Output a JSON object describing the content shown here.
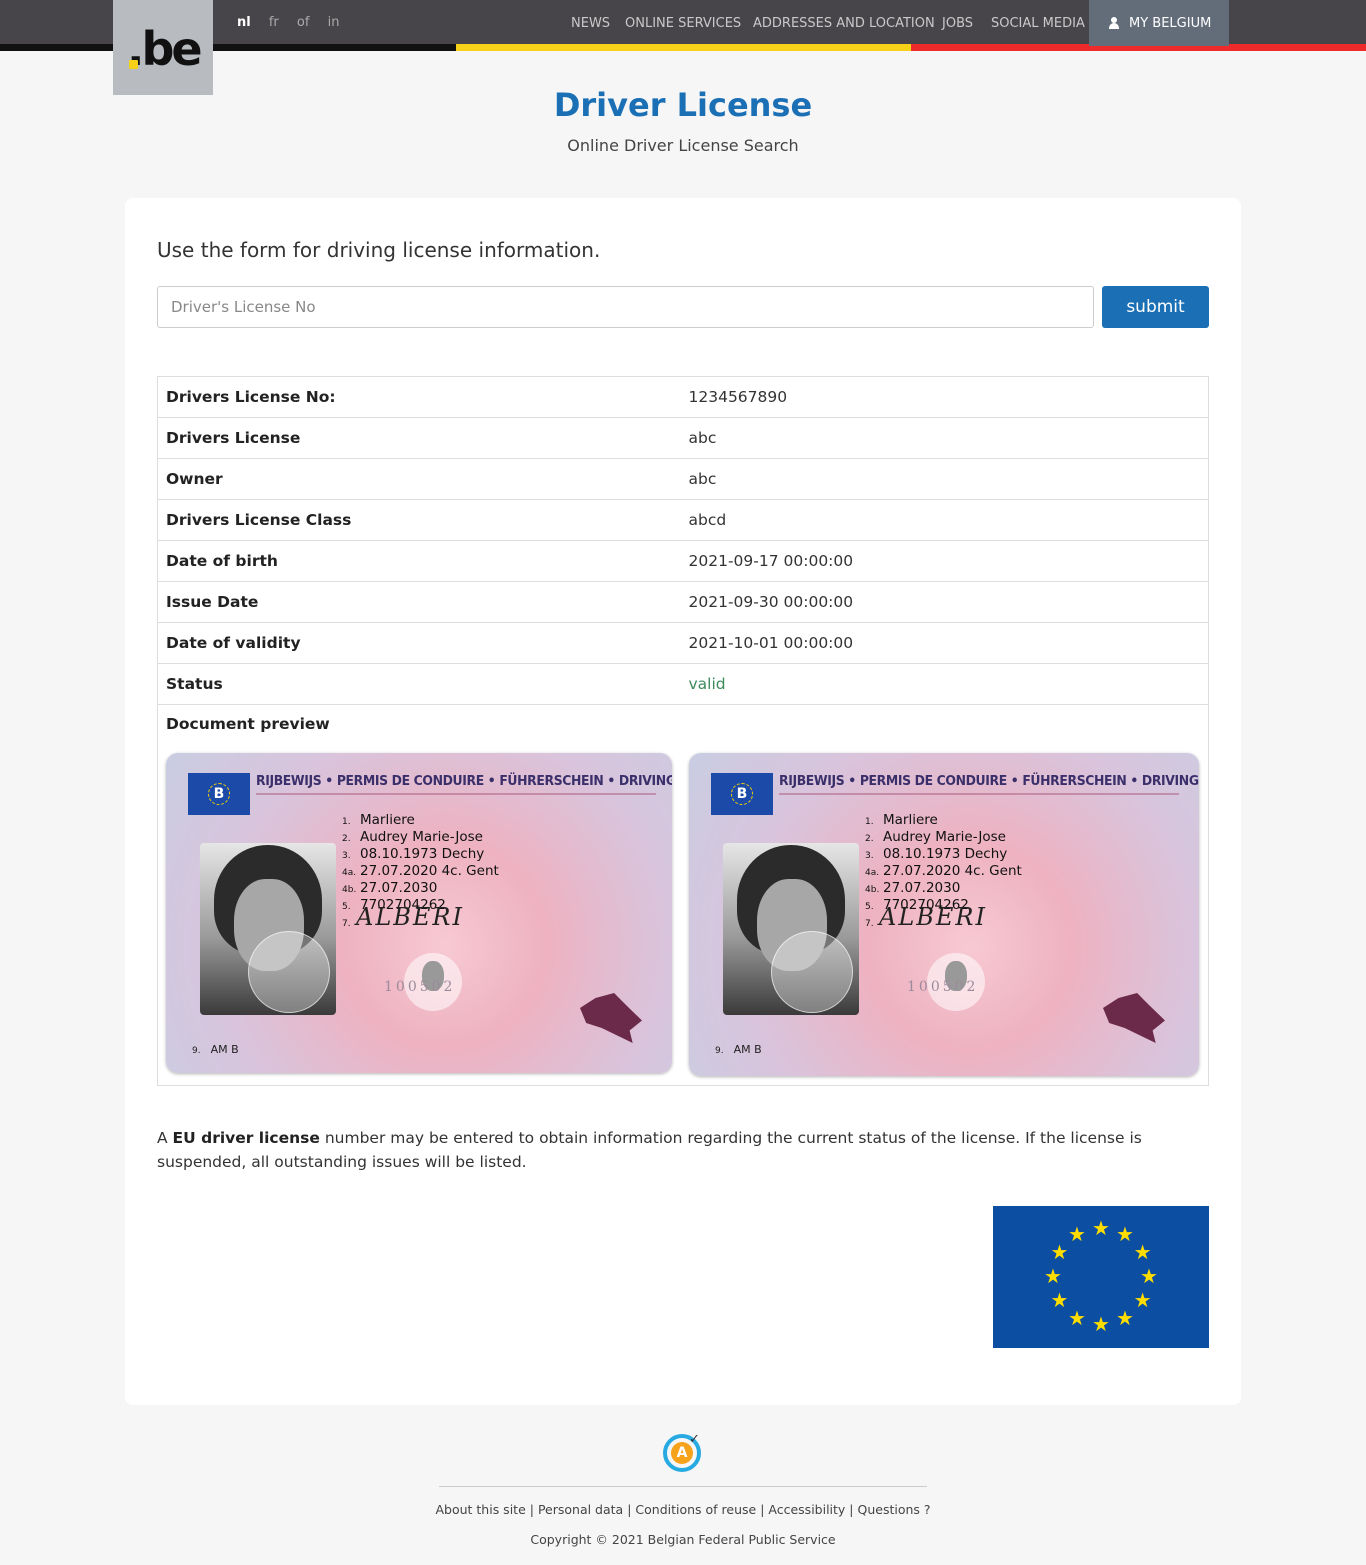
{
  "header": {
    "logo_text": ".be",
    "languages": [
      {
        "code": "nl",
        "active": true
      },
      {
        "code": "fr",
        "active": false
      },
      {
        "code": "of",
        "active": false
      },
      {
        "code": "in",
        "active": false
      }
    ],
    "nav": [
      "NEWS",
      "ONLINE SERVICES",
      "ADDRESSES AND LOCATION",
      "JOBS",
      "SOCIAL MEDIA"
    ],
    "my_belgium": "MY BELGIUM",
    "stripe_colors": [
      "#111111",
      "#f7d117",
      "#ee2a2a"
    ]
  },
  "page": {
    "title": "Driver License",
    "subtitle": "Online Driver License Search"
  },
  "form": {
    "heading": "Use the form for driving license information.",
    "placeholder": "Driver's License No",
    "value": "",
    "submit_label": "submit"
  },
  "details": {
    "rows": [
      {
        "label": "Drivers License No:",
        "value": "1234567890"
      },
      {
        "label": "Drivers License",
        "value": "abc"
      },
      {
        "label": "Owner",
        "value": "abc"
      },
      {
        "label": "Drivers License Class",
        "value": "abcd"
      },
      {
        "label": "Date of birth",
        "value": "2021-09-17 00:00:00"
      },
      {
        "label": "Issue Date",
        "value": "2021-09-30 00:00:00"
      },
      {
        "label": "Date of validity",
        "value": "2021-10-01 00:00:00"
      },
      {
        "label": "Status",
        "value": "valid",
        "status_color": "#3d8a5c"
      }
    ],
    "preview_label": "Document preview"
  },
  "license_card": {
    "eu_letter": "B",
    "header": "RIJBEWIJS • PERMIS DE CONDUIRE • FÜHRERSCHEIN • DRIVING LICENCE",
    "fields": [
      {
        "num": "1.",
        "text": "Marliere"
      },
      {
        "num": "2.",
        "text": "Audrey Marie-Jose"
      },
      {
        "num": "3.",
        "text": "08.10.1973  Dechy"
      },
      {
        "num": "4a.",
        "text": "27.07.2020  4c. Gent"
      },
      {
        "num": "4b.",
        "text": "27.07.2030"
      },
      {
        "num": "5.",
        "text": "7702704262"
      },
      {
        "num": "7.",
        "text": ""
      }
    ],
    "signature": "ALBERI",
    "serial": "100502",
    "category_num": "9.",
    "category": "AM B"
  },
  "explanation": {
    "prefix": "A ",
    "bold": "EU driver license",
    "suffix": " number may be entered to obtain information regarding the current status of the license. If the license is suspended, all outstanding issues will be listed."
  },
  "eu_flag": {
    "background": "#0b4ea2",
    "star_color": "#ffdd00",
    "star_count": 12
  },
  "footer": {
    "accessibility_icon": "accessibility-icon",
    "links": [
      "About this site",
      "Personal data",
      "Conditions of reuse",
      "Accessibility",
      "Questions ?"
    ],
    "copyright": "Copyright © 2021 Belgian Federal Public Service"
  },
  "colors": {
    "accent": "#1a6fb5",
    "header_bg": "#474549",
    "my_belgium_bg": "#636d7a"
  }
}
